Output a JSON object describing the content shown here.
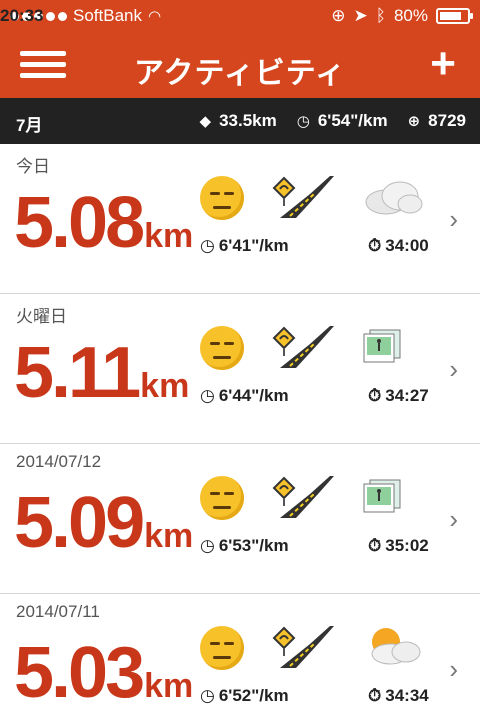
{
  "status": {
    "carrier": "SoftBank",
    "time": "20:33",
    "battery": "80%",
    "battery_level": 0.8
  },
  "nav": {
    "title": "アクティビティ",
    "add_label": "+"
  },
  "summary": {
    "month": "7月",
    "distance": "33.5km",
    "pace": "6'54\"/km",
    "fuel": "8729"
  },
  "activities": [
    {
      "date": "今日",
      "distance": "5.08",
      "unit": "km",
      "pace": "6'41\"/km",
      "duration": "34:00",
      "extra": "cloud"
    },
    {
      "date": "火曜日",
      "distance": "5.11",
      "unit": "km",
      "pace": "6'44\"/km",
      "duration": "34:27",
      "extra": "photo"
    },
    {
      "date": "2014/07/12",
      "distance": "5.09",
      "unit": "km",
      "pace": "6'53\"/km",
      "duration": "35:02",
      "extra": "photo"
    },
    {
      "date": "2014/07/11",
      "distance": "5.03",
      "unit": "km",
      "pace": "6'52\"/km",
      "duration": "34:34",
      "extra": "sun-cloud"
    }
  ],
  "colors": {
    "brand": "#d5451e",
    "distance": "#c8371a",
    "summary_bg": "#222222"
  }
}
